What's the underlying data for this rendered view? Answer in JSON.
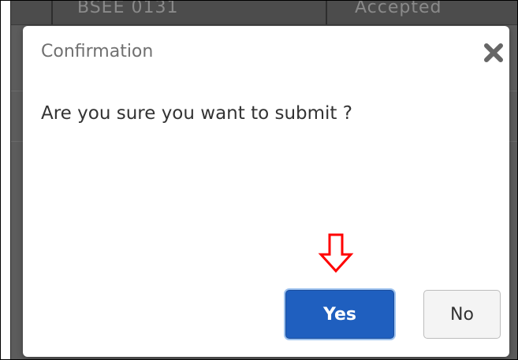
{
  "background": {
    "table_row": [
      "BSEE 0131",
      "Accepted"
    ]
  },
  "dialog": {
    "title": "Confirmation",
    "message": "Are you sure you want to submit ?",
    "yes_label": "Yes",
    "no_label": "No",
    "close_icon": "close-icon",
    "annotation_icon": "down-arrow-icon"
  },
  "colors": {
    "primary_button": "#1f5fbf",
    "annotation": "#ff0000",
    "overlay": "#5c5c5c"
  }
}
